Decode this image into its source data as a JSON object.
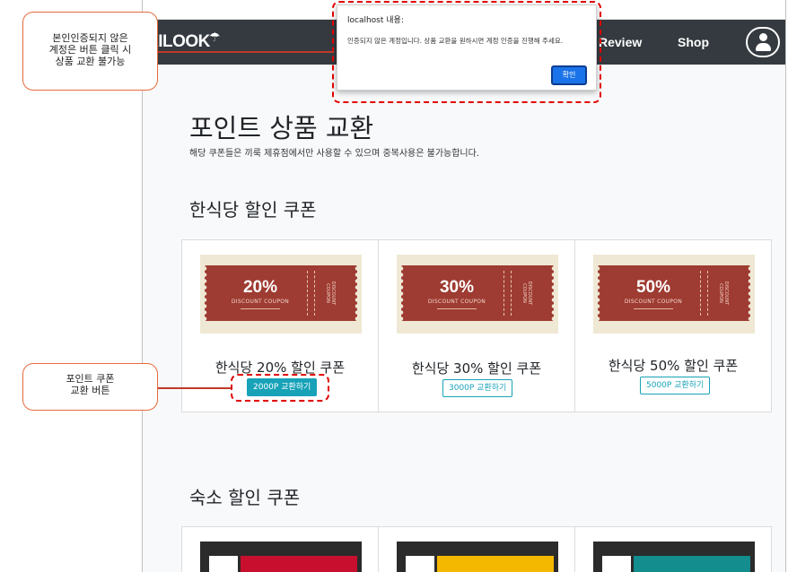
{
  "navbar": {
    "logo": "KILOOK",
    "review": "Review",
    "shop": "Shop"
  },
  "dialog": {
    "title": "localhost 내용:",
    "message": "인증되지 않은 계정입니다. 상품 교환을 원하시면 계정 인증을 진행해 주세요.",
    "ok": "확인"
  },
  "page": {
    "title": "포인트 상품 교환",
    "subtitle": "해당 쿠폰들은 끼룩 제휴점에서만 사용할 수 있으며 중복사용은 불가능합니다."
  },
  "sections": [
    {
      "title": "한식당 할인 쿠폰",
      "items": [
        {
          "percent": "20%",
          "name": "한식당 20% 할인 쿠폰",
          "button": "2000P 교환하기"
        },
        {
          "percent": "30%",
          "name": "한식당 30% 할인 쿠폰",
          "button": "3000P 교환하기"
        },
        {
          "percent": "50%",
          "name": "한식당 50% 할인 쿠폰",
          "button": "5000P 교환하기"
        }
      ]
    },
    {
      "title": "숙소 할인 쿠폰"
    }
  ],
  "coupon": {
    "discount_text": "DISCOUNT COUPON",
    "side_text": "DISCOUNT COUPON"
  },
  "annotations": {
    "unverified": "본인인증되지 않은\n계정은 버튼 클릭 시\n상품 교환 불가능",
    "exchange_button": "포인트 쿠폰\n교환 버튼"
  },
  "colors": {
    "navbar": "#343a40",
    "coupon_red": "#9e3b32",
    "teal": "#17a2b8",
    "annotation": "#e56b3c",
    "highlight": "#e00000"
  }
}
